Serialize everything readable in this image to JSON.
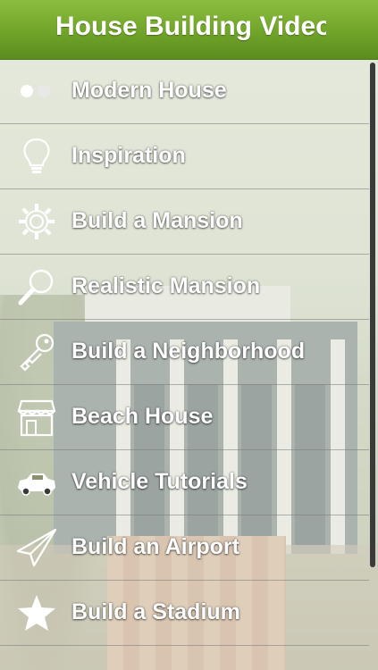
{
  "header": {
    "title": "House Building Videos"
  },
  "menu": {
    "items": [
      {
        "label": "Modern House",
        "icon": "two-dots-icon"
      },
      {
        "label": "Inspiration",
        "icon": "lightbulb-icon"
      },
      {
        "label": "Build a Mansion",
        "icon": "gear-icon"
      },
      {
        "label": "Realistic Mansion",
        "icon": "magnifier-icon"
      },
      {
        "label": "Build a Neighborhood",
        "icon": "key-icon"
      },
      {
        "label": "Beach House",
        "icon": "shop-icon"
      },
      {
        "label": "Vehicle Tutorials",
        "icon": "car-icon"
      },
      {
        "label": "Build an Airport",
        "icon": "paper-plane-icon"
      },
      {
        "label": "Build a Stadium",
        "icon": "star-icon"
      }
    ]
  },
  "colors": {
    "header_green": "#73a62b",
    "label_white": "#ffffff"
  }
}
